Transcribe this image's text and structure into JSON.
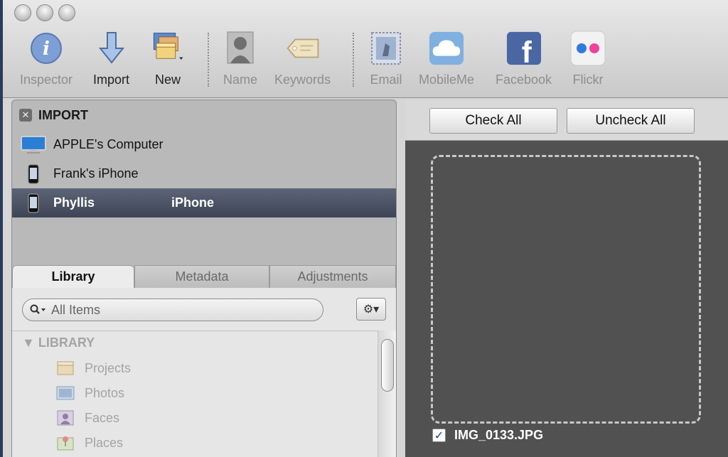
{
  "toolbar": {
    "inspector": "Inspector",
    "import": "Import",
    "new": "New",
    "name": "Name",
    "keywords": "Keywords",
    "email": "Email",
    "mobileme": "MobileMe",
    "facebook": "Facebook",
    "flickr": "Flickr"
  },
  "import_panel": {
    "title": "IMPORT",
    "sources": [
      {
        "label": "APPLE's Computer",
        "icon": "computer-icon"
      },
      {
        "label": "Frank's iPhone",
        "icon": "iphone-icon"
      },
      {
        "label_first": "Phyllis",
        "label_last": "iPhone",
        "icon": "iphone-icon",
        "selected": true
      }
    ]
  },
  "tabs": {
    "library": "Library",
    "metadata": "Metadata",
    "adjustments": "Adjustments"
  },
  "search": {
    "placeholder": "All Items"
  },
  "library": {
    "header": "LIBRARY",
    "items": [
      {
        "label": "Projects",
        "icon": "projects-icon"
      },
      {
        "label": "Photos",
        "icon": "photos-icon"
      },
      {
        "label": "Faces",
        "icon": "faces-icon"
      },
      {
        "label": "Places",
        "icon": "places-icon"
      }
    ]
  },
  "browser": {
    "check_all": "Check All",
    "uncheck_all": "Uncheck All",
    "file_name": "IMG_0133.JPG"
  },
  "colors": {
    "selection": "#4a5366",
    "browser_bg": "#515151",
    "facebook_blue": "#3b5998",
    "flickr_pink": "#ff0084",
    "flickr_blue": "#0063dc"
  }
}
